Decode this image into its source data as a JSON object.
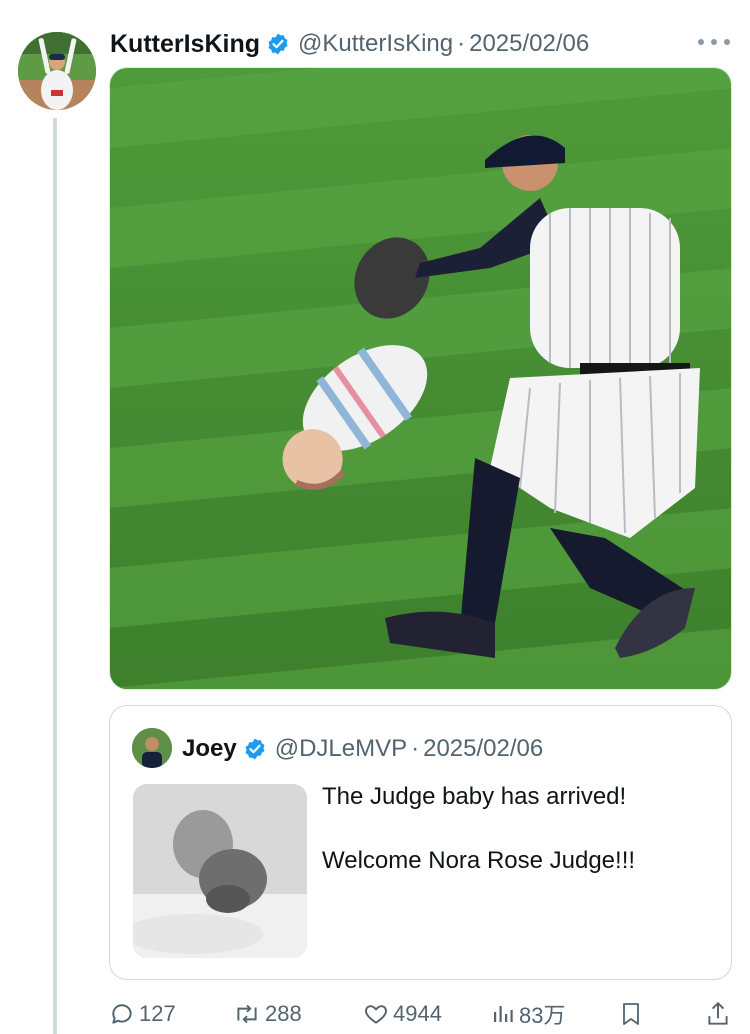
{
  "post": {
    "author_name": "KutterIsKing",
    "author_handle": "@KutterIsKing",
    "separator": "·",
    "date": "2025/02/06",
    "media_description": "Yankees outfielder in pinstripes about to catch a swaddled baby"
  },
  "quote": {
    "author_name": "Joey",
    "author_handle": "@DJLeMVP",
    "separator": "·",
    "date": "2025/02/06",
    "text_line1": "The Judge baby has arrived!",
    "text_line2": "Welcome Nora Rose Judge!!!"
  },
  "actions": {
    "replies": "127",
    "reposts": "288",
    "likes": "4944",
    "views": "83万"
  },
  "colors": {
    "verified": "#1d9bf0",
    "secondary_text": "#536471",
    "thread_line": "#cfd9de"
  }
}
